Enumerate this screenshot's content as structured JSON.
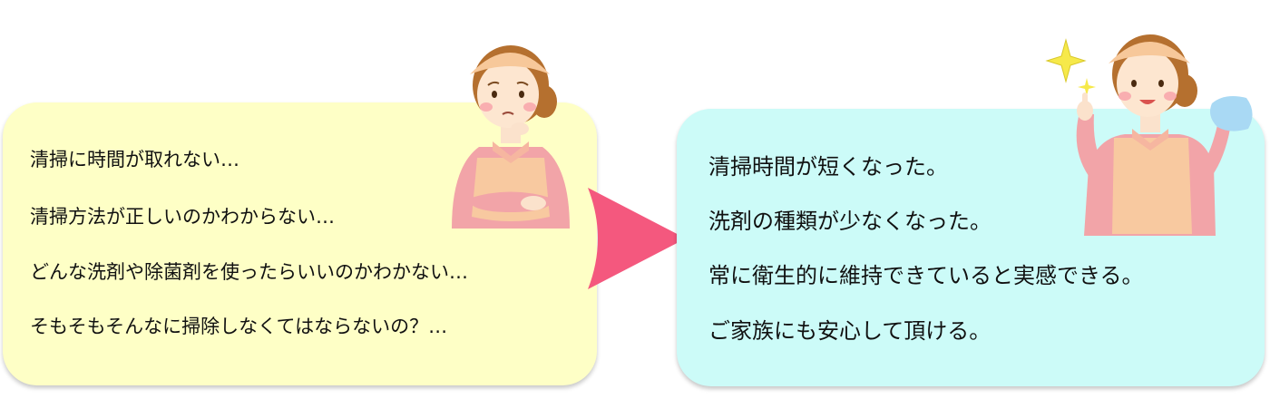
{
  "before": {
    "lines": [
      "清掃に時間が取れない…",
      "清掃方法が正しいのかわからない…",
      "どんな洗剤や除菌剤を使ったらいいのかわかない…",
      "そもそもそんなに掃除しなくてはならないの？…"
    ]
  },
  "after": {
    "lines": [
      "清掃時間が短くなった。",
      "洗剤の種類が少なくなった。",
      "常に衛生的に維持できていると実感できる。",
      "ご家族にも安心して頂ける。"
    ]
  },
  "colors": {
    "before_panel": "#feffc6",
    "after_panel": "#ccfbf8",
    "arrow": "#f4587e",
    "apron": "#f8c9a0",
    "shirt": "#f2a4a8"
  },
  "icons": {
    "arrow": "right-arrow-icon",
    "worried_person": "worried-housekeeper-icon",
    "happy_person": "happy-housekeeper-icon",
    "sparkle": "sparkle-icon",
    "cloth": "cleaning-cloth-icon"
  }
}
